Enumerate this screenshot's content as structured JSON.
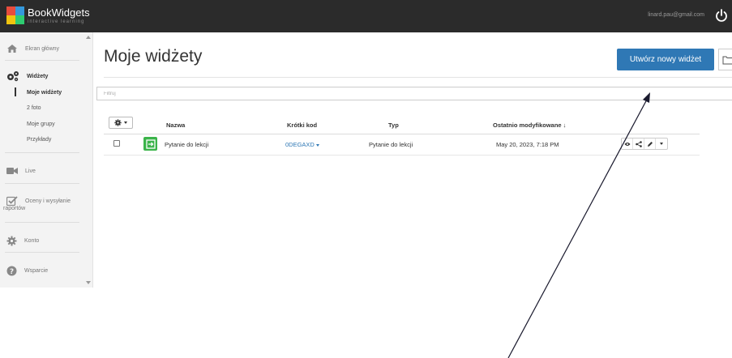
{
  "topbar": {
    "logo_name": "BookWidgets",
    "logo_sub": "interactive learning",
    "user_email": "linard.pau@gmail.com",
    "icons": [
      "power-icon"
    ]
  },
  "sidebar": {
    "items": [
      {
        "label": "Ekran główny",
        "icon": "home-icon"
      },
      {
        "label": "Widżety",
        "icon": "gears-icon"
      },
      {
        "label": "Live",
        "icon": "video-icon"
      },
      {
        "label": "Oceny i wysyłanie raportów",
        "icon": "check-icon"
      },
      {
        "label": "Konto",
        "icon": "gear-icon"
      },
      {
        "label": "Wsparcie",
        "icon": "help-icon"
      }
    ],
    "sub_items": [
      {
        "label": "Moje widżety",
        "active": true
      },
      {
        "label": "2 foto"
      },
      {
        "label": "Moje grupy"
      },
      {
        "label": "Przykłady"
      }
    ],
    "raport_wrap": "raportów",
    "oceny_line1": "Oceny i wysyłanie"
  },
  "main": {
    "title": "Moje widżety",
    "create_button": "Utwórz nowy widżet",
    "filter_placeholder": "Filtruj",
    "table": {
      "columns": [
        "Nazwa",
        "Krótki kod",
        "Typ",
        "Ostatnio modyfikowane ↓"
      ],
      "rows": [
        {
          "name": "Pytanie do lekcji",
          "code": "0DEGAXD",
          "type": "Pytanie do lekcji",
          "modified": "May 20, 2023, 7:18 PM"
        }
      ]
    }
  },
  "colors": {
    "topbar": "#2b2b2b",
    "primary": "#2f78b5",
    "widget_icon": "#3bb44a"
  }
}
